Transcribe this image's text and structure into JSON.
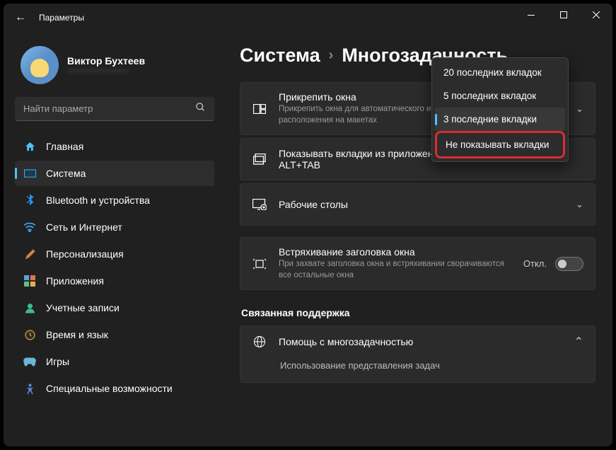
{
  "window": {
    "title": "Параметры"
  },
  "profile": {
    "name": "Виктор Бухтеев",
    "sub": "————————"
  },
  "search": {
    "placeholder": "Найти параметр"
  },
  "nav": [
    {
      "key": "home",
      "label": "Главная"
    },
    {
      "key": "system",
      "label": "Система",
      "active": true
    },
    {
      "key": "bt",
      "label": "Bluetooth и устройства"
    },
    {
      "key": "net",
      "label": "Сеть и Интернет"
    },
    {
      "key": "pers",
      "label": "Персонализация"
    },
    {
      "key": "apps",
      "label": "Приложения"
    },
    {
      "key": "acct",
      "label": "Учетные записи"
    },
    {
      "key": "time",
      "label": "Время и язык"
    },
    {
      "key": "game",
      "label": "Игры"
    },
    {
      "key": "access",
      "label": "Специальные возможности"
    }
  ],
  "breadcrumb": {
    "root": "Система",
    "page": "Многозадачность"
  },
  "cards": {
    "snap": {
      "title": "Прикрепить окна",
      "sub": "Прикрепить окна для автоматического изменения их размера и расположения на макетах"
    },
    "tabs": {
      "title": "Показывать вкладки из приложений при привязке или нажатии ALT+TAB"
    },
    "desks": {
      "title": "Рабочие столы"
    },
    "shake": {
      "title": "Встряхивание заголовка окна",
      "sub": "При захвате заголовка окна и встряхивании сворачиваются все остальные окна",
      "state": "Откл."
    }
  },
  "dropdown": {
    "options": [
      "20 последних вкладок",
      "5 последних вкладок",
      "3 последние вкладки",
      "Не показывать вкладки"
    ],
    "selected_index": 2,
    "highlighted_index": 3
  },
  "support": {
    "heading": "Связанная поддержка",
    "help_title": "Помощь с многозадачностью",
    "sub1": "Использование представления задач"
  }
}
